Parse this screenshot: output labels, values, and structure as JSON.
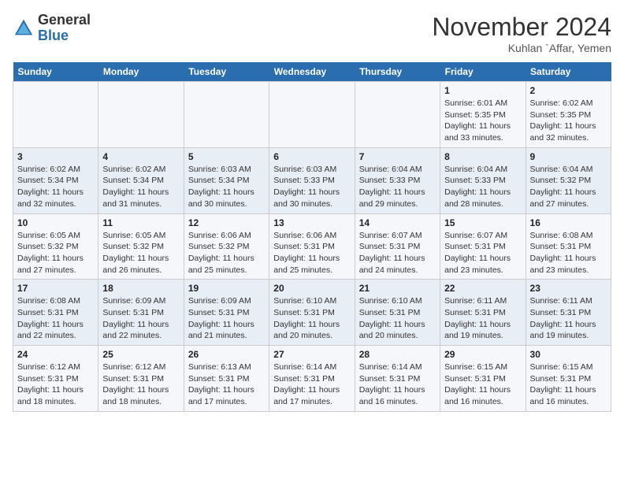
{
  "header": {
    "logo_general": "General",
    "logo_blue": "Blue",
    "month_title": "November 2024",
    "location": "Kuhlan `Affar, Yemen"
  },
  "weekdays": [
    "Sunday",
    "Monday",
    "Tuesday",
    "Wednesday",
    "Thursday",
    "Friday",
    "Saturday"
  ],
  "weeks": [
    [
      {
        "day": "",
        "info": ""
      },
      {
        "day": "",
        "info": ""
      },
      {
        "day": "",
        "info": ""
      },
      {
        "day": "",
        "info": ""
      },
      {
        "day": "",
        "info": ""
      },
      {
        "day": "1",
        "info": "Sunrise: 6:01 AM\nSunset: 5:35 PM\nDaylight: 11 hours and 33 minutes."
      },
      {
        "day": "2",
        "info": "Sunrise: 6:02 AM\nSunset: 5:35 PM\nDaylight: 11 hours and 32 minutes."
      }
    ],
    [
      {
        "day": "3",
        "info": "Sunrise: 6:02 AM\nSunset: 5:34 PM\nDaylight: 11 hours and 32 minutes."
      },
      {
        "day": "4",
        "info": "Sunrise: 6:02 AM\nSunset: 5:34 PM\nDaylight: 11 hours and 31 minutes."
      },
      {
        "day": "5",
        "info": "Sunrise: 6:03 AM\nSunset: 5:34 PM\nDaylight: 11 hours and 30 minutes."
      },
      {
        "day": "6",
        "info": "Sunrise: 6:03 AM\nSunset: 5:33 PM\nDaylight: 11 hours and 30 minutes."
      },
      {
        "day": "7",
        "info": "Sunrise: 6:04 AM\nSunset: 5:33 PM\nDaylight: 11 hours and 29 minutes."
      },
      {
        "day": "8",
        "info": "Sunrise: 6:04 AM\nSunset: 5:33 PM\nDaylight: 11 hours and 28 minutes."
      },
      {
        "day": "9",
        "info": "Sunrise: 6:04 AM\nSunset: 5:32 PM\nDaylight: 11 hours and 27 minutes."
      }
    ],
    [
      {
        "day": "10",
        "info": "Sunrise: 6:05 AM\nSunset: 5:32 PM\nDaylight: 11 hours and 27 minutes."
      },
      {
        "day": "11",
        "info": "Sunrise: 6:05 AM\nSunset: 5:32 PM\nDaylight: 11 hours and 26 minutes."
      },
      {
        "day": "12",
        "info": "Sunrise: 6:06 AM\nSunset: 5:32 PM\nDaylight: 11 hours and 25 minutes."
      },
      {
        "day": "13",
        "info": "Sunrise: 6:06 AM\nSunset: 5:31 PM\nDaylight: 11 hours and 25 minutes."
      },
      {
        "day": "14",
        "info": "Sunrise: 6:07 AM\nSunset: 5:31 PM\nDaylight: 11 hours and 24 minutes."
      },
      {
        "day": "15",
        "info": "Sunrise: 6:07 AM\nSunset: 5:31 PM\nDaylight: 11 hours and 23 minutes."
      },
      {
        "day": "16",
        "info": "Sunrise: 6:08 AM\nSunset: 5:31 PM\nDaylight: 11 hours and 23 minutes."
      }
    ],
    [
      {
        "day": "17",
        "info": "Sunrise: 6:08 AM\nSunset: 5:31 PM\nDaylight: 11 hours and 22 minutes."
      },
      {
        "day": "18",
        "info": "Sunrise: 6:09 AM\nSunset: 5:31 PM\nDaylight: 11 hours and 22 minutes."
      },
      {
        "day": "19",
        "info": "Sunrise: 6:09 AM\nSunset: 5:31 PM\nDaylight: 11 hours and 21 minutes."
      },
      {
        "day": "20",
        "info": "Sunrise: 6:10 AM\nSunset: 5:31 PM\nDaylight: 11 hours and 20 minutes."
      },
      {
        "day": "21",
        "info": "Sunrise: 6:10 AM\nSunset: 5:31 PM\nDaylight: 11 hours and 20 minutes."
      },
      {
        "day": "22",
        "info": "Sunrise: 6:11 AM\nSunset: 5:31 PM\nDaylight: 11 hours and 19 minutes."
      },
      {
        "day": "23",
        "info": "Sunrise: 6:11 AM\nSunset: 5:31 PM\nDaylight: 11 hours and 19 minutes."
      }
    ],
    [
      {
        "day": "24",
        "info": "Sunrise: 6:12 AM\nSunset: 5:31 PM\nDaylight: 11 hours and 18 minutes."
      },
      {
        "day": "25",
        "info": "Sunrise: 6:12 AM\nSunset: 5:31 PM\nDaylight: 11 hours and 18 minutes."
      },
      {
        "day": "26",
        "info": "Sunrise: 6:13 AM\nSunset: 5:31 PM\nDaylight: 11 hours and 17 minutes."
      },
      {
        "day": "27",
        "info": "Sunrise: 6:14 AM\nSunset: 5:31 PM\nDaylight: 11 hours and 17 minutes."
      },
      {
        "day": "28",
        "info": "Sunrise: 6:14 AM\nSunset: 5:31 PM\nDaylight: 11 hours and 16 minutes."
      },
      {
        "day": "29",
        "info": "Sunrise: 6:15 AM\nSunset: 5:31 PM\nDaylight: 11 hours and 16 minutes."
      },
      {
        "day": "30",
        "info": "Sunrise: 6:15 AM\nSunset: 5:31 PM\nDaylight: 11 hours and 16 minutes."
      }
    ]
  ]
}
